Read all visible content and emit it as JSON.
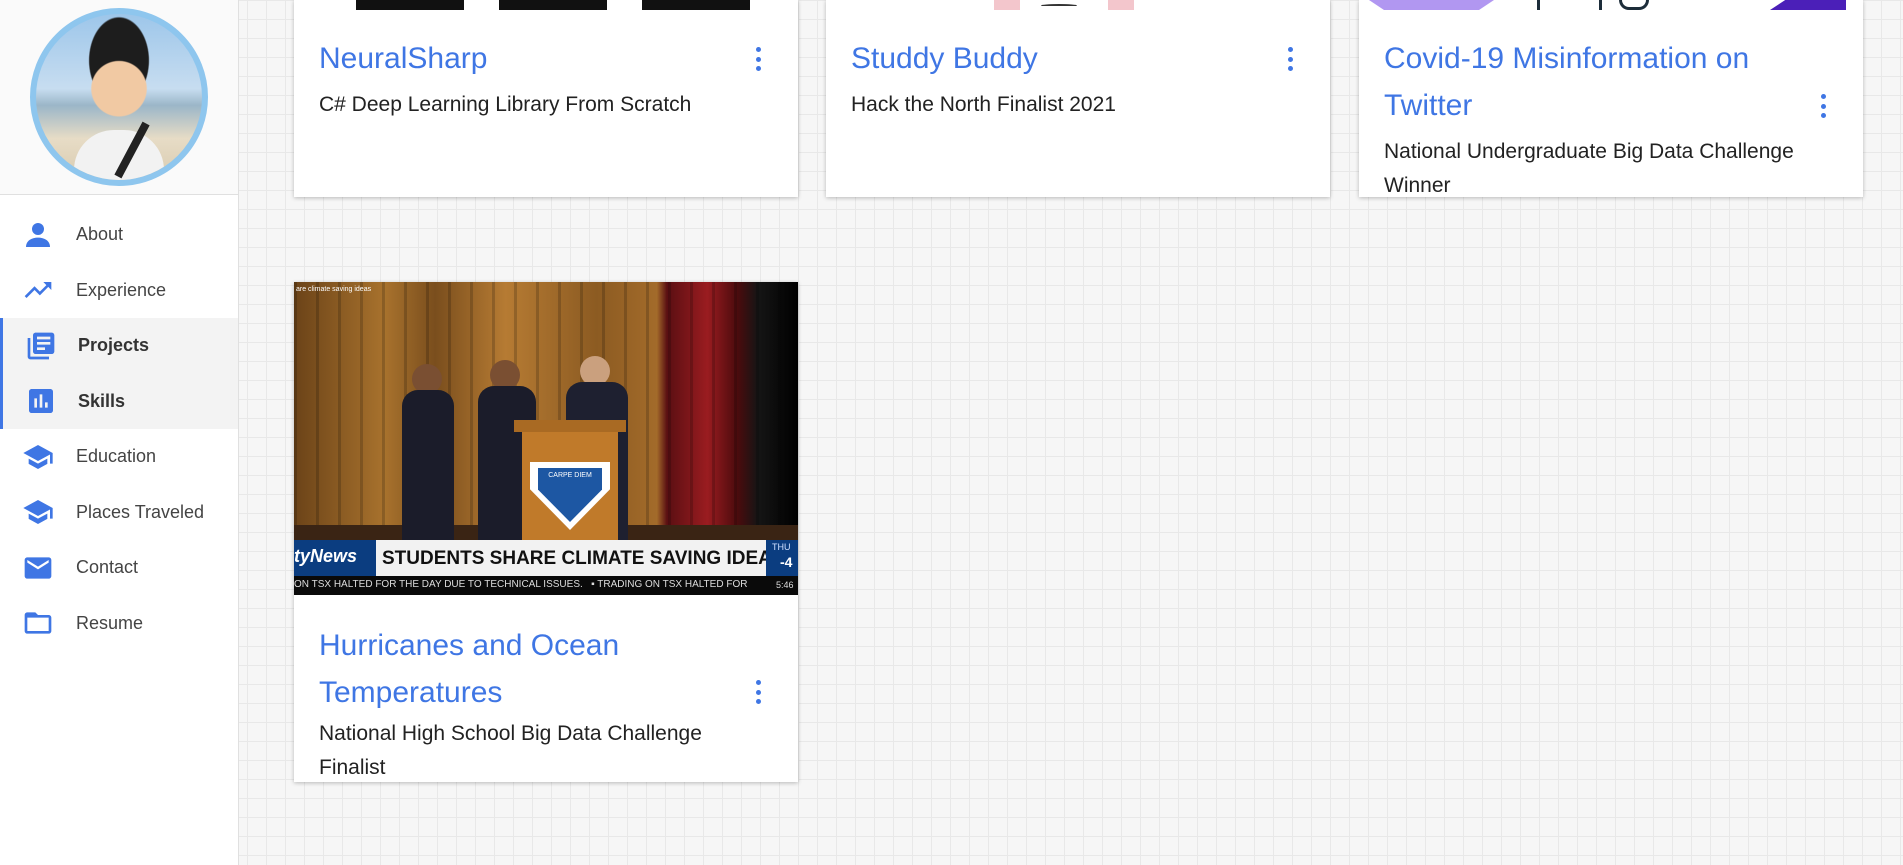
{
  "sidebar": {
    "items": [
      {
        "label": "About",
        "icon": "person-icon",
        "active": false
      },
      {
        "label": "Experience",
        "icon": "trending-up-icon",
        "active": false
      },
      {
        "label": "Projects",
        "icon": "projects-list-icon",
        "active": true
      },
      {
        "label": "Skills",
        "icon": "bar-chart-icon",
        "active": true
      },
      {
        "label": "Education",
        "icon": "school-icon",
        "active": false
      },
      {
        "label": "Places Traveled",
        "icon": "school-icon",
        "active": false
      },
      {
        "label": "Contact",
        "icon": "mail-icon",
        "active": false
      },
      {
        "label": "Resume",
        "icon": "folder-icon",
        "active": false
      }
    ]
  },
  "cards": [
    {
      "title": "NeuralSharp",
      "subtitle": "C# Deep Learning Library From Scratch"
    },
    {
      "title": "Studdy Buddy",
      "subtitle": "Hack the North Finalist 2021"
    },
    {
      "title": "Covid-19 Misinformation on Twitter",
      "subtitle": "National Undergraduate Big Data Challenge Winner"
    },
    {
      "title": "Hurricanes and Ocean Temperatures",
      "subtitle": "National High School Big Data Challenge Finalist"
    }
  ],
  "news_image": {
    "top_caption": "are climate saving ideas",
    "logo": "tyNews",
    "headline": "STUDENTS SHARE CLIMATE SAVING IDEAS",
    "day": "THU",
    "temp": "-4",
    "ticker": "ON TSX HALTED FOR THE DAY DUE TO TECHNICAL ISSUES.   ▪ TRADING ON TSX HALTED FOR",
    "time": "5:46",
    "crest_top": "CARPE DIEM"
  },
  "colors": {
    "accent": "#3f76e4"
  }
}
